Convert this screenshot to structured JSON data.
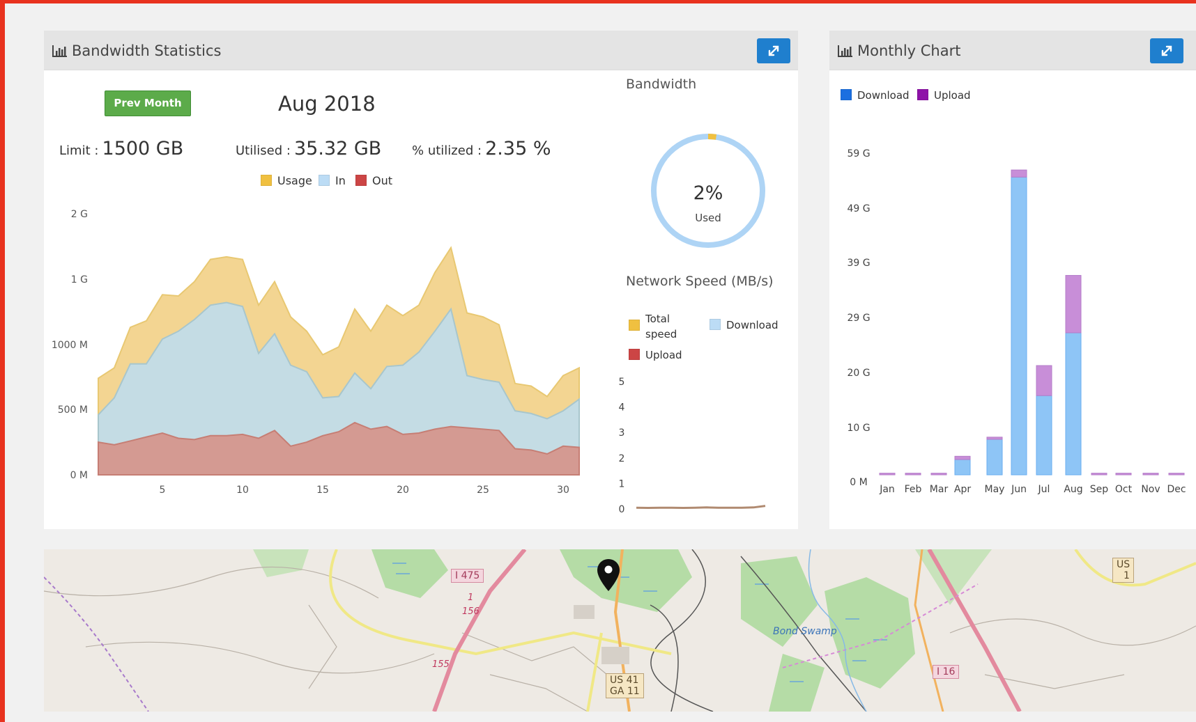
{
  "colors": {
    "accent_red": "#e8321e",
    "button_blue": "#1f7fce",
    "button_green": "#5cab4a",
    "usage": "#f3d592",
    "in": "#c4dce4",
    "out": "#d49a92",
    "donut": "#aed4f5",
    "download_bar": "#8ec5f6",
    "upload_bar": "#c88ed8"
  },
  "bandwidth_panel": {
    "title": "Bandwidth Statistics",
    "title_icon": "bar-chart-icon",
    "expand_icon": "expand-icon",
    "prev_button": "Prev Month",
    "month": "Aug 2018",
    "limit_label": "Limit :",
    "limit_value": "1500 GB",
    "utilised_label": "Utilised :",
    "utilised_value": "35.32 GB",
    "percent_label": "% utilized :",
    "percent_value": "2.35 %"
  },
  "bandwidth_side": {
    "heading": "Bandwidth",
    "donut_value": "2%",
    "donut_label": "Used",
    "network_heading": "Network Speed (MB/s)",
    "legend_total_line1": "Total",
    "legend_total_line2": "speed",
    "legend_download": "Download",
    "legend_upload": "Upload"
  },
  "monthly_panel": {
    "title": "Monthly Chart",
    "title_icon": "bar-chart-icon",
    "expand_icon": "expand-icon",
    "legend_download": "Download",
    "legend_upload": "Upload",
    "legend_download_color": "#1b6fe0",
    "legend_upload_color": "#8e12a8"
  },
  "map": {
    "labels": [
      "I 475",
      "I 16",
      "Bond Swamp",
      "156",
      "155",
      "1",
      "US 41",
      "GA 11",
      "US",
      "1"
    ],
    "marker_icon": "map-marker-icon"
  },
  "chart_data": [
    {
      "type": "area",
      "legend": [
        "Usage",
        "In",
        "Out"
      ],
      "x": [
        1,
        2,
        3,
        4,
        5,
        6,
        7,
        8,
        9,
        10,
        11,
        12,
        13,
        14,
        15,
        16,
        17,
        18,
        19,
        20,
        21,
        22,
        23,
        24,
        25,
        26,
        27,
        28,
        29,
        30,
        31
      ],
      "series": [
        {
          "name": "Usage",
          "values": [
            740,
            820,
            1130,
            1180,
            1380,
            1370,
            1480,
            1650,
            1670,
            1650,
            1300,
            1480,
            1210,
            1100,
            920,
            980,
            1270,
            1100,
            1300,
            1220,
            1300,
            1550,
            1740,
            1240,
            1210,
            1150,
            700,
            680,
            600,
            760,
            820
          ]
        },
        {
          "name": "In",
          "values": [
            460,
            590,
            850,
            850,
            1040,
            1100,
            1190,
            1300,
            1320,
            1290,
            930,
            1080,
            840,
            790,
            590,
            600,
            780,
            660,
            830,
            840,
            940,
            1100,
            1270,
            760,
            730,
            710,
            490,
            470,
            430,
            490,
            580
          ]
        },
        {
          "name": "Out",
          "values": [
            250,
            230,
            260,
            290,
            320,
            280,
            270,
            300,
            300,
            310,
            280,
            340,
            220,
            250,
            300,
            330,
            400,
            350,
            370,
            310,
            320,
            350,
            370,
            360,
            350,
            340,
            200,
            190,
            160,
            220,
            210
          ]
        }
      ],
      "y_ticks": [
        "0 M",
        "500 M",
        "1000 M",
        "1 G",
        "2 G"
      ],
      "x_ticks": [
        "5",
        "10",
        "15",
        "20",
        "25",
        "30"
      ],
      "ylim": [
        0,
        2000
      ]
    },
    {
      "type": "pie",
      "values": [
        2.35,
        97.65
      ],
      "title": "Bandwidth"
    },
    {
      "type": "line",
      "title": "Network Speed (MB/s)",
      "legend": [
        "Total speed",
        "Download",
        "Upload"
      ],
      "y_ticks": [
        "0",
        "1",
        "2",
        "3",
        "4",
        "5"
      ],
      "ylim": [
        0,
        5
      ],
      "series": [
        {
          "name": "Total speed",
          "values": [
            0.05,
            0.04,
            0.05,
            0.05,
            0.04,
            0.05,
            0.06,
            0.05,
            0.05,
            0.05,
            0.06,
            0.12
          ]
        }
      ]
    },
    {
      "type": "bar",
      "categories": [
        "Jan",
        "Feb",
        "Mar",
        "Apr",
        "May",
        "Jun",
        "Jul",
        "Aug",
        "Sep",
        "Oct",
        "Nov",
        "Dec"
      ],
      "series": [
        {
          "name": "Download",
          "values": [
            0,
            0,
            0,
            2.8,
            6.5,
            54.5,
            14.5,
            26.0,
            0,
            0,
            0,
            0
          ]
        },
        {
          "name": "Upload",
          "values": [
            0.3,
            0.3,
            0.3,
            0.6,
            0.4,
            1.3,
            5.5,
            10.5,
            0.3,
            0.3,
            0.3,
            0.3
          ]
        }
      ],
      "y_ticks": [
        "0 M",
        "10 G",
        "20 G",
        "29 G",
        "39 G",
        "49 G",
        "59 G"
      ],
      "ylim": [
        0,
        59
      ]
    }
  ]
}
